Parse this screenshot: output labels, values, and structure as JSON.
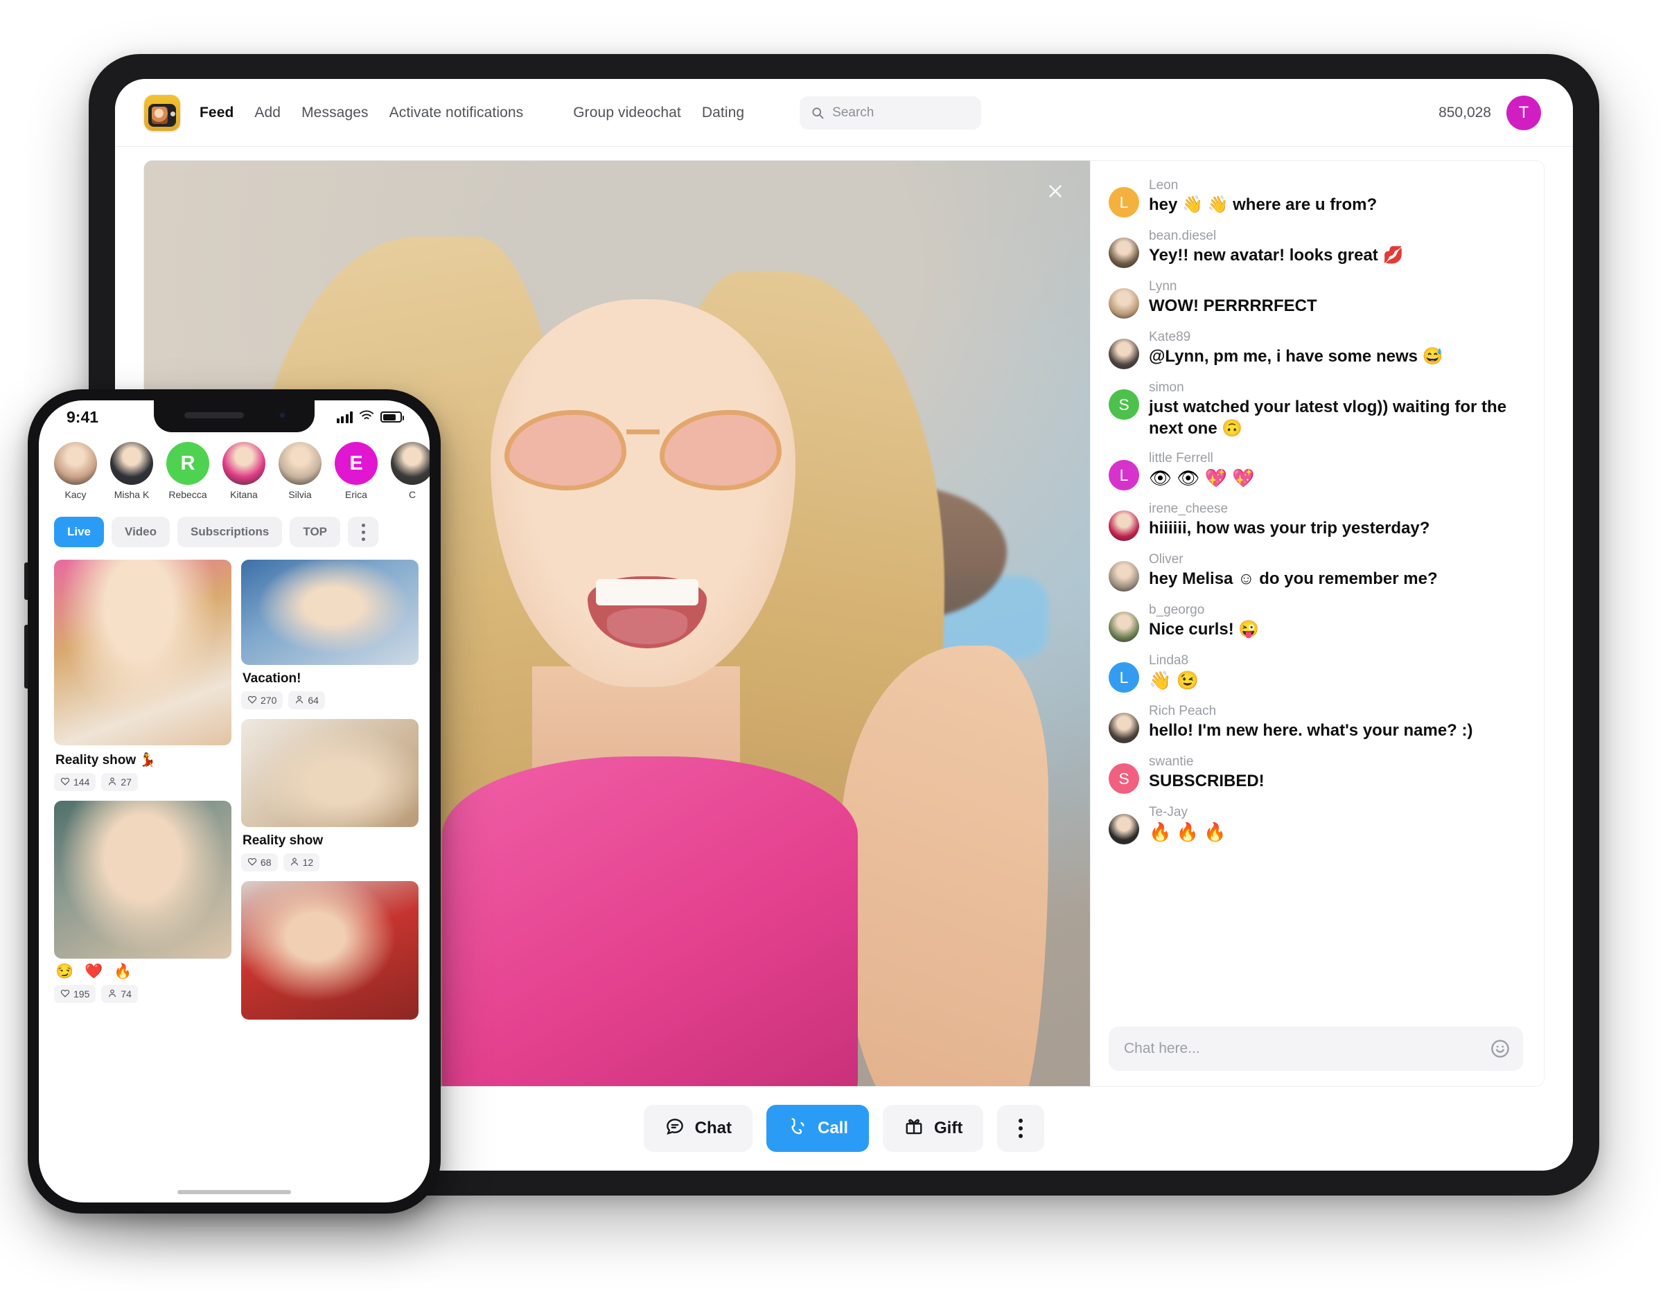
{
  "web": {
    "header": {
      "logo_icon": "tv-app-logo-icon",
      "nav": [
        {
          "label": "Feed",
          "active": true
        },
        {
          "label": "Add",
          "active": false
        },
        {
          "label": "Messages",
          "active": false
        },
        {
          "label": "Activate notifications",
          "active": false
        },
        {
          "label": "Group videochat",
          "active": false
        },
        {
          "label": "Dating",
          "active": false
        }
      ],
      "search": {
        "placeholder": "Search",
        "icon": "search-icon"
      },
      "coins": "850,028",
      "avatar_letter": "T",
      "avatar_color": "#d01ec2"
    },
    "stream": {
      "close_icon": "close-icon"
    },
    "chat": {
      "messages": [
        {
          "user": "Leon",
          "text": "hey 👋 👋  where are u from?",
          "avatar_type": "letter",
          "letter": "L",
          "color": "#f5b13d"
        },
        {
          "user": "bean.diesel",
          "text": "Yey!! new avatar! looks great 💋",
          "avatar_type": "photo",
          "color": "#6d5a46"
        },
        {
          "user": "Lynn",
          "text": "WOW! PERRRRFECT",
          "avatar_type": "photo",
          "color": "#b99a78"
        },
        {
          "user": "Kate89",
          "text": "@Lynn, pm me, i have some news 😅",
          "avatar_type": "photo",
          "color": "#4c4340"
        },
        {
          "user": "simon",
          "text": "just watched your latest vlog)) waiting for the next one 🙃",
          "avatar_type": "letter",
          "letter": "S",
          "color": "#4cc14c"
        },
        {
          "user": "little Ferrell",
          "text": "👁 👁 💖 💖",
          "avatar_type": "letter",
          "letter": "L",
          "color": "#d633cc",
          "emoji_only": true
        },
        {
          "user": "irene_cheese",
          "text": "hiiiiii, how was your trip yesterday?",
          "avatar_type": "photo",
          "color": "#c2204f"
        },
        {
          "user": "Oliver",
          "text": "hey Melisa ☺  do you remember me?",
          "avatar_type": "photo",
          "color": "#9b8f7e"
        },
        {
          "user": "b_georgo",
          "text": "Nice curls! 😜",
          "avatar_type": "photo",
          "color": "#6b7f52"
        },
        {
          "user": "Linda8",
          "text": "👋 😉",
          "avatar_type": "letter",
          "letter": "L",
          "color": "#339cf0",
          "emoji_only": true
        },
        {
          "user": "Rich Peach",
          "text": "hello! I'm new here. what's your name? :)",
          "avatar_type": "photo",
          "color": "#4a4038"
        },
        {
          "user": "swantie",
          "text": "SUBSCRIBED!",
          "avatar_type": "letter",
          "letter": "S",
          "color": "#f2607f"
        },
        {
          "user": "Te-Jay",
          "text": "🔥 🔥 🔥",
          "avatar_type": "photo",
          "color": "#2b2b2b",
          "emoji_only": true
        }
      ],
      "input_placeholder": "Chat here...",
      "emoji_icon": "smiley-icon"
    },
    "toolbar": [
      {
        "label": "Chat",
        "icon": "chat-bubble-icon",
        "primary": false
      },
      {
        "label": "Call",
        "icon": "phone-call-icon",
        "primary": true
      },
      {
        "label": "Gift",
        "icon": "gift-icon",
        "primary": false
      },
      {
        "label": "",
        "icon": "more-vertical-icon",
        "primary": false
      }
    ],
    "accent_color": "#2a9cf5"
  },
  "phone": {
    "status": {
      "time": "9:41",
      "signal_icon": "cellular-signal-icon",
      "wifi_icon": "wifi-icon",
      "battery_icon": "battery-icon"
    },
    "stories": [
      {
        "name": "Kacy",
        "type": "photo",
        "color": "#caa287"
      },
      {
        "name": "Misha K",
        "type": "photo",
        "color": "#2e3239"
      },
      {
        "name": "Rebecca",
        "type": "letter",
        "letter": "R",
        "color": "#4fd24f"
      },
      {
        "name": "Kitana",
        "type": "photo",
        "color": "#e03b86"
      },
      {
        "name": "Silvia",
        "type": "photo",
        "color": "#c8b39e"
      },
      {
        "name": "Erica",
        "type": "letter",
        "letter": "E",
        "color": "#e016d0"
      },
      {
        "name": "C",
        "type": "photo",
        "color": "#3a3a3a"
      }
    ],
    "filters": [
      {
        "label": "Live",
        "active": true
      },
      {
        "label": "Video",
        "active": false
      },
      {
        "label": "Subscriptions",
        "active": false
      },
      {
        "label": "TOP",
        "active": false
      }
    ],
    "filter_more_icon": "more-vertical-icon",
    "feed": {
      "left": [
        {
          "title": "Reality show 💃",
          "likes": "144",
          "viewers": "27",
          "art": "a1"
        },
        {
          "emoji": "😏 ❤️ 🔥",
          "likes": "195",
          "viewers": "74",
          "art": "a4"
        }
      ],
      "right": [
        {
          "title": "Vacation!",
          "likes": "270",
          "viewers": "64",
          "art": "a2"
        },
        {
          "title": "Reality show",
          "likes": "68",
          "viewers": "12",
          "art": "a3"
        },
        {
          "title": "",
          "likes": "",
          "viewers": "",
          "art": "a5"
        }
      ],
      "like_icon": "heart-icon",
      "viewer_icon": "person-icon"
    }
  }
}
